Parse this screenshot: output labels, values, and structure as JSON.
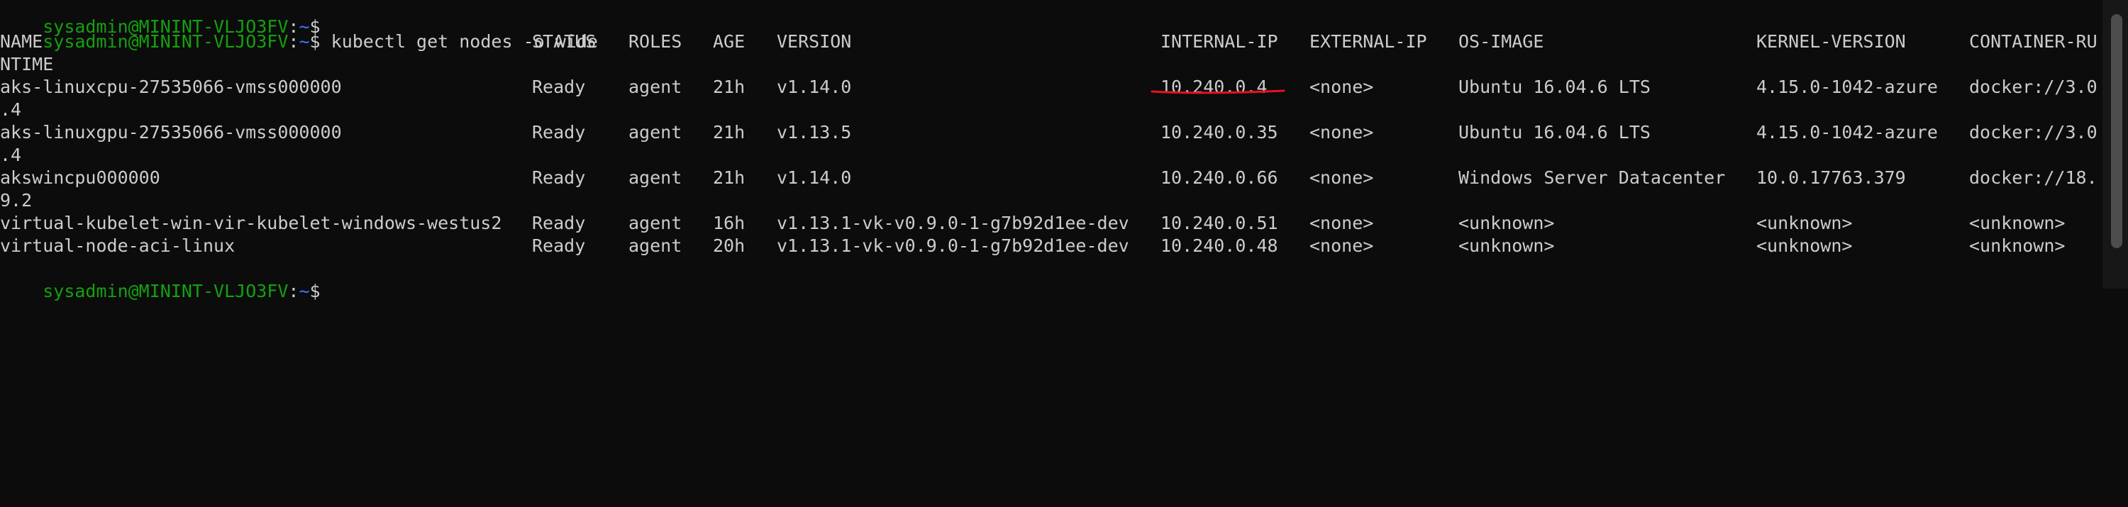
{
  "prompt_top": {
    "user": "sysadmin@MININT-VLJO3FV",
    "sep": ":",
    "path": "~",
    "symbol": "$",
    "command": " kubectl get nodes -o wide"
  },
  "table": {
    "headers": [
      "NAME",
      "STATUS",
      "ROLES",
      "AGE",
      "VERSION",
      "INTERNAL-IP",
      "EXTERNAL-IP",
      "OS-IMAGE",
      "KERNEL-VERSION",
      "CONTAINER-RU"
    ],
    "header_wrap": "NTIME",
    "rows": [
      {
        "cells": [
          "aks-linuxcpu-27535066-vmss000000",
          "Ready",
          "agent",
          "21h",
          "v1.14.0",
          "10.240.0.4",
          "<none>",
          "Ubuntu 16.04.6 LTS",
          "4.15.0-1042-azure",
          "docker://3.0"
        ],
        "wrap": ".4"
      },
      {
        "cells": [
          "aks-linuxgpu-27535066-vmss000000",
          "Ready",
          "agent",
          "21h",
          "v1.13.5",
          "10.240.0.35",
          "<none>",
          "Ubuntu 16.04.6 LTS",
          "4.15.0-1042-azure",
          "docker://3.0"
        ],
        "wrap": ".4"
      },
      {
        "cells": [
          "akswincpu000000",
          "Ready",
          "agent",
          "21h",
          "v1.14.0",
          "10.240.0.66",
          "<none>",
          "Windows Server Datacenter",
          "10.0.17763.379",
          "docker://18."
        ],
        "wrap": "9.2"
      },
      {
        "cells": [
          "virtual-kubelet-win-vir-kubelet-windows-westus2",
          "Ready",
          "agent",
          "16h",
          "v1.13.1-vk-v0.9.0-1-g7b92d1ee-dev",
          "10.240.0.51",
          "<none>",
          "<unknown>",
          "<unknown>",
          "<unknown>"
        ]
      },
      {
        "cells": [
          "virtual-node-aci-linux",
          "Ready",
          "agent",
          "20h",
          "v1.13.1-vk-v0.9.0-1-g7b92d1ee-dev",
          "10.240.0.48",
          "<none>",
          "<unknown>",
          "<unknown>",
          "<unknown>"
        ]
      }
    ]
  },
  "prompt_bottom": {
    "user": "sysadmin@MININT-VLJO3FV",
    "sep": ":",
    "path": "~",
    "symbol": "$"
  },
  "colors": {
    "background": "#0c0c0c",
    "text": "#cccccc",
    "user": "#13a10e",
    "path": "#3b78ff",
    "annotation": "#e81123"
  }
}
